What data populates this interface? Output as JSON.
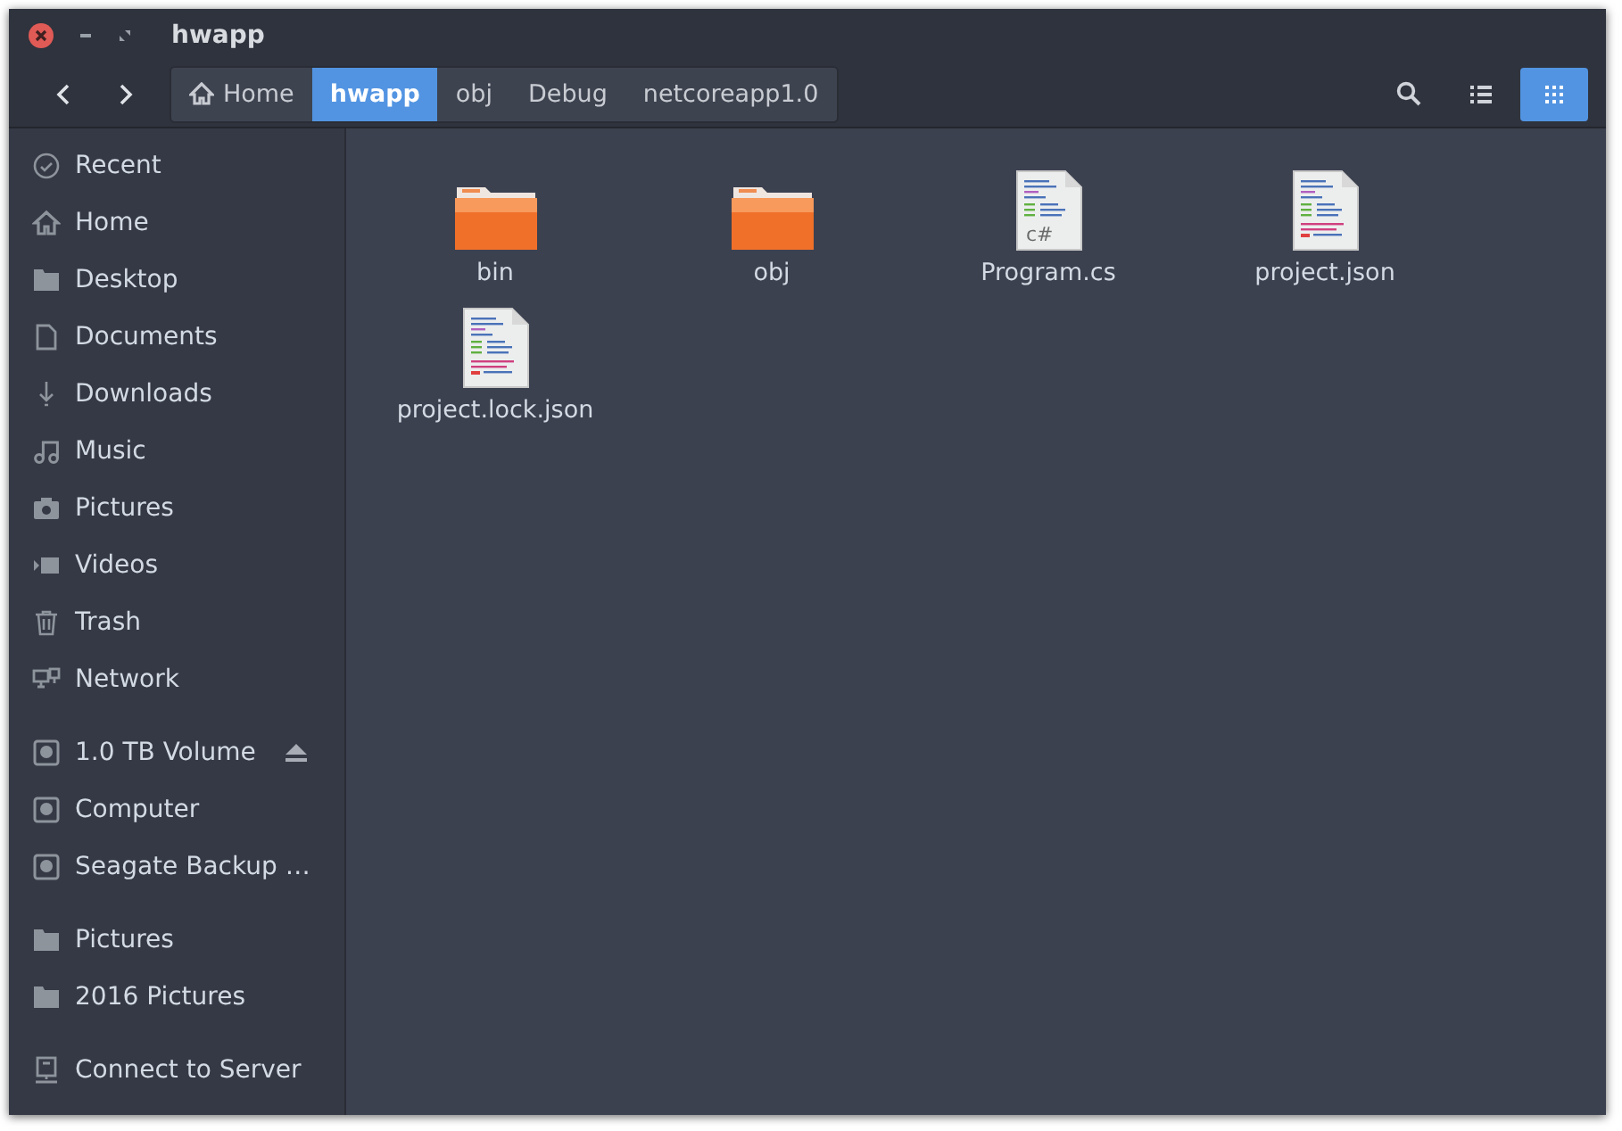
{
  "window": {
    "title": "hwapp"
  },
  "path": [
    {
      "label": "Home",
      "kind": "home",
      "selected": false
    },
    {
      "label": "hwapp",
      "selected": true
    },
    {
      "label": "obj",
      "selected": false
    },
    {
      "label": "Debug",
      "selected": false
    },
    {
      "label": "netcoreapp1.0",
      "selected": false
    }
  ],
  "view_buttons": [
    {
      "kind": "list",
      "selected": false
    },
    {
      "kind": "grid",
      "selected": true
    }
  ],
  "sidebar": {
    "sections": [
      {
        "items": [
          {
            "kind": "recent",
            "label": "Recent"
          },
          {
            "kind": "home",
            "label": "Home"
          },
          {
            "kind": "folder",
            "label": "Desktop"
          },
          {
            "kind": "document",
            "label": "Documents"
          },
          {
            "kind": "download",
            "label": "Downloads"
          },
          {
            "kind": "music",
            "label": "Music"
          },
          {
            "kind": "camera",
            "label": "Pictures"
          },
          {
            "kind": "video",
            "label": "Videos"
          },
          {
            "kind": "trash",
            "label": "Trash"
          },
          {
            "kind": "network",
            "label": "Network"
          }
        ]
      },
      {
        "items": [
          {
            "kind": "drive",
            "label": "1.0 TB Volume",
            "eject": true
          },
          {
            "kind": "drive",
            "label": "Computer"
          },
          {
            "kind": "drive",
            "label": "Seagate Backup …"
          }
        ]
      },
      {
        "items": [
          {
            "kind": "folder",
            "label": "Pictures"
          },
          {
            "kind": "folder",
            "label": "2016 Pictures"
          }
        ]
      },
      {
        "items": [
          {
            "kind": "server",
            "label": "Connect to Server"
          }
        ]
      }
    ]
  },
  "files": [
    {
      "kind": "folder",
      "label": "bin"
    },
    {
      "kind": "folder",
      "label": "obj"
    },
    {
      "kind": "code",
      "label": "Program.cs",
      "badge": "c#"
    },
    {
      "kind": "code",
      "label": "project.json"
    },
    {
      "kind": "code",
      "label": "project.lock.json"
    }
  ]
}
